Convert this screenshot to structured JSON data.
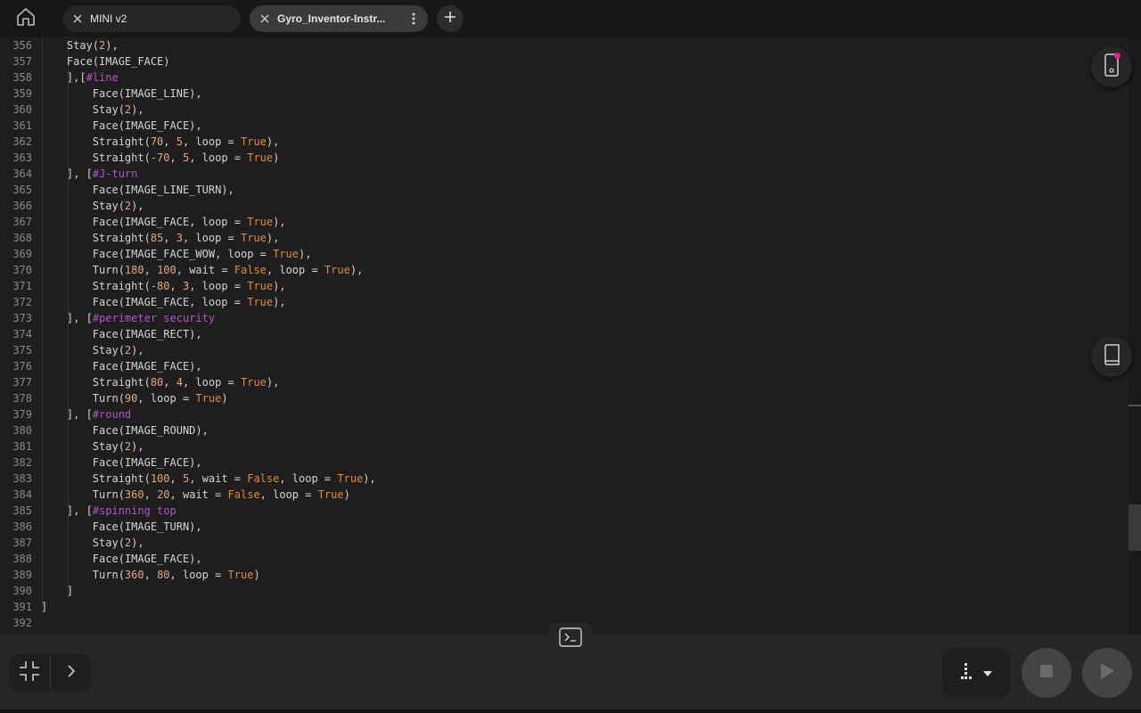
{
  "tabs": [
    {
      "label": "MINI v2",
      "active": false
    },
    {
      "label": "Gyro_Inventor-Instr...",
      "active": true
    }
  ],
  "icons": {
    "home": "home-icon",
    "close": "close-icon",
    "more": "more-vertical-icon",
    "add": "plus-icon",
    "device": "phone-device-icon",
    "book": "book-icon",
    "terminal": "terminal-icon",
    "shrink": "shrink-icon",
    "expand": "chevron-right-icon",
    "device_select": "bar-chart-icon",
    "stop": "stop-icon",
    "run": "play-icon"
  },
  "colors": {
    "background": "#1e1e1e",
    "number": "#e2a97a",
    "keyword": "#e08a3c",
    "comment": "#b255c9",
    "notification_dot": "#e91e8c"
  },
  "code": [
    {
      "ln": "356",
      "indent": 1,
      "tokens": [
        [
          "t",
          "Stay("
        ],
        [
          "n",
          "2"
        ],
        [
          "t",
          "),"
        ]
      ]
    },
    {
      "ln": "357",
      "indent": 1,
      "tokens": [
        [
          "t",
          "Face(IMAGE_FACE)"
        ]
      ]
    },
    {
      "ln": "358",
      "indent": 1,
      "tokens": [
        [
          "t",
          "],["
        ],
        [
          "c",
          "#line"
        ]
      ]
    },
    {
      "ln": "359",
      "indent": 2,
      "tokens": [
        [
          "t",
          "Face(IMAGE_LINE),"
        ]
      ]
    },
    {
      "ln": "360",
      "indent": 2,
      "tokens": [
        [
          "t",
          "Stay("
        ],
        [
          "n",
          "2"
        ],
        [
          "t",
          "),"
        ]
      ]
    },
    {
      "ln": "361",
      "indent": 2,
      "tokens": [
        [
          "t",
          "Face(IMAGE_FACE),"
        ]
      ]
    },
    {
      "ln": "362",
      "indent": 2,
      "tokens": [
        [
          "t",
          "Straight("
        ],
        [
          "n",
          "70"
        ],
        [
          "t",
          ", "
        ],
        [
          "n",
          "5"
        ],
        [
          "t",
          ", loop = "
        ],
        [
          "k",
          "True"
        ],
        [
          "t",
          "),"
        ]
      ]
    },
    {
      "ln": "363",
      "indent": 2,
      "tokens": [
        [
          "t",
          "Straight("
        ],
        [
          "n",
          "-70"
        ],
        [
          "t",
          ", "
        ],
        [
          "n",
          "5"
        ],
        [
          "t",
          ", loop = "
        ],
        [
          "k",
          "True"
        ],
        [
          "t",
          ")"
        ]
      ]
    },
    {
      "ln": "364",
      "indent": 1,
      "tokens": [
        [
          "t",
          "], ["
        ],
        [
          "c",
          "#J-turn"
        ]
      ]
    },
    {
      "ln": "365",
      "indent": 2,
      "tokens": [
        [
          "t",
          "Face(IMAGE_LINE_TURN),"
        ]
      ]
    },
    {
      "ln": "366",
      "indent": 2,
      "tokens": [
        [
          "t",
          "Stay("
        ],
        [
          "n",
          "2"
        ],
        [
          "t",
          "),"
        ]
      ]
    },
    {
      "ln": "367",
      "indent": 2,
      "tokens": [
        [
          "t",
          "Face(IMAGE_FACE, loop = "
        ],
        [
          "k",
          "True"
        ],
        [
          "t",
          "),"
        ]
      ]
    },
    {
      "ln": "368",
      "indent": 2,
      "tokens": [
        [
          "t",
          "Straight("
        ],
        [
          "n",
          "85"
        ],
        [
          "t",
          ", "
        ],
        [
          "n",
          "3"
        ],
        [
          "t",
          ", loop = "
        ],
        [
          "k",
          "True"
        ],
        [
          "t",
          "),"
        ]
      ]
    },
    {
      "ln": "369",
      "indent": 2,
      "tokens": [
        [
          "t",
          "Face(IMAGE_FACE_WOW, loop = "
        ],
        [
          "k",
          "True"
        ],
        [
          "t",
          "),"
        ]
      ]
    },
    {
      "ln": "370",
      "indent": 2,
      "tokens": [
        [
          "t",
          "Turn("
        ],
        [
          "n",
          "180"
        ],
        [
          "t",
          ", "
        ],
        [
          "n",
          "100"
        ],
        [
          "t",
          ", wait = "
        ],
        [
          "k",
          "False"
        ],
        [
          "t",
          ", loop = "
        ],
        [
          "k",
          "True"
        ],
        [
          "t",
          "),"
        ]
      ]
    },
    {
      "ln": "371",
      "indent": 2,
      "tokens": [
        [
          "t",
          "Straight("
        ],
        [
          "n",
          "-80"
        ],
        [
          "t",
          ", "
        ],
        [
          "n",
          "3"
        ],
        [
          "t",
          ", loop = "
        ],
        [
          "k",
          "True"
        ],
        [
          "t",
          "),"
        ]
      ]
    },
    {
      "ln": "372",
      "indent": 2,
      "tokens": [
        [
          "t",
          "Face(IMAGE_FACE, loop = "
        ],
        [
          "k",
          "True"
        ],
        [
          "t",
          "),"
        ]
      ]
    },
    {
      "ln": "373",
      "indent": 1,
      "tokens": [
        [
          "t",
          "], ["
        ],
        [
          "c",
          "#perimeter security"
        ]
      ]
    },
    {
      "ln": "374",
      "indent": 2,
      "tokens": [
        [
          "t",
          "Face(IMAGE_RECT),"
        ]
      ]
    },
    {
      "ln": "375",
      "indent": 2,
      "tokens": [
        [
          "t",
          "Stay("
        ],
        [
          "n",
          "2"
        ],
        [
          "t",
          "),"
        ]
      ]
    },
    {
      "ln": "376",
      "indent": 2,
      "tokens": [
        [
          "t",
          "Face(IMAGE_FACE),"
        ]
      ]
    },
    {
      "ln": "377",
      "indent": 2,
      "tokens": [
        [
          "t",
          "Straight("
        ],
        [
          "n",
          "80"
        ],
        [
          "t",
          ", "
        ],
        [
          "n",
          "4"
        ],
        [
          "t",
          ", loop = "
        ],
        [
          "k",
          "True"
        ],
        [
          "t",
          "),"
        ]
      ]
    },
    {
      "ln": "378",
      "indent": 2,
      "tokens": [
        [
          "t",
          "Turn("
        ],
        [
          "n",
          "90"
        ],
        [
          "t",
          ", loop = "
        ],
        [
          "k",
          "True"
        ],
        [
          "t",
          ")"
        ]
      ]
    },
    {
      "ln": "379",
      "indent": 1,
      "tokens": [
        [
          "t",
          "], ["
        ],
        [
          "c",
          "#round"
        ]
      ]
    },
    {
      "ln": "380",
      "indent": 2,
      "tokens": [
        [
          "t",
          "Face(IMAGE_ROUND),"
        ]
      ]
    },
    {
      "ln": "381",
      "indent": 2,
      "tokens": [
        [
          "t",
          "Stay("
        ],
        [
          "n",
          "2"
        ],
        [
          "t",
          "),"
        ]
      ]
    },
    {
      "ln": "382",
      "indent": 2,
      "tokens": [
        [
          "t",
          "Face(IMAGE_FACE),"
        ]
      ]
    },
    {
      "ln": "383",
      "indent": 2,
      "tokens": [
        [
          "t",
          "Straight("
        ],
        [
          "n",
          "100"
        ],
        [
          "t",
          ", "
        ],
        [
          "n",
          "5"
        ],
        [
          "t",
          ", wait = "
        ],
        [
          "k",
          "False"
        ],
        [
          "t",
          ", loop = "
        ],
        [
          "k",
          "True"
        ],
        [
          "t",
          "),"
        ]
      ]
    },
    {
      "ln": "384",
      "indent": 2,
      "tokens": [
        [
          "t",
          "Turn("
        ],
        [
          "n",
          "360"
        ],
        [
          "t",
          ", "
        ],
        [
          "n",
          "20"
        ],
        [
          "t",
          ", wait = "
        ],
        [
          "k",
          "False"
        ],
        [
          "t",
          ", loop = "
        ],
        [
          "k",
          "True"
        ],
        [
          "t",
          ")"
        ]
      ]
    },
    {
      "ln": "385",
      "indent": 1,
      "tokens": [
        [
          "t",
          "], ["
        ],
        [
          "c",
          "#spinning top"
        ]
      ]
    },
    {
      "ln": "386",
      "indent": 2,
      "tokens": [
        [
          "t",
          "Face(IMAGE_TURN),"
        ]
      ]
    },
    {
      "ln": "387",
      "indent": 2,
      "tokens": [
        [
          "t",
          "Stay("
        ],
        [
          "n",
          "2"
        ],
        [
          "t",
          "),"
        ]
      ]
    },
    {
      "ln": "388",
      "indent": 2,
      "tokens": [
        [
          "t",
          "Face(IMAGE_FACE),"
        ]
      ]
    },
    {
      "ln": "389",
      "indent": 2,
      "tokens": [
        [
          "t",
          "Turn("
        ],
        [
          "n",
          "360"
        ],
        [
          "t",
          ", "
        ],
        [
          "n",
          "80"
        ],
        [
          "t",
          ", loop = "
        ],
        [
          "k",
          "True"
        ],
        [
          "t",
          ")"
        ]
      ]
    },
    {
      "ln": "390",
      "indent": 1,
      "tokens": [
        [
          "t",
          "]"
        ]
      ]
    },
    {
      "ln": "391",
      "indent": 0,
      "tokens": [
        [
          "t",
          "]"
        ]
      ]
    },
    {
      "ln": "392",
      "indent": 0,
      "tokens": []
    }
  ]
}
